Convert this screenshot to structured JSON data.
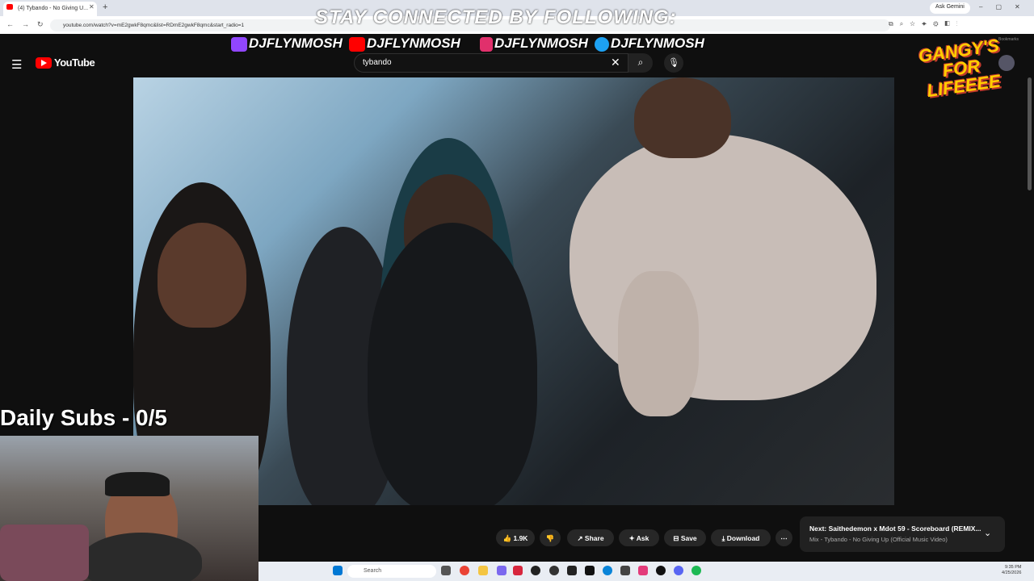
{
  "browser": {
    "tab_title": "(4) Tybando - No Giving U...",
    "url": "youtube.com/watch?v=mE2gwkF8qmc&list=RDmE2gwkF8qmc&start_radio=1",
    "ask_gemini": "Ask Gemini",
    "bookmarks_label": "Bookmarks"
  },
  "overlay": {
    "stay_connected": "STAY CONNECTED BY FOLLOWING:",
    "socials": [
      "DJFLYNMOSH",
      "DJFLYNMOSH",
      "DJFLYNMOSH",
      "DJFLYNMOSH"
    ],
    "daily_subs": "Daily Subs - 0/5",
    "gang_badge": "GANGY'S FOR LIFEEEE"
  },
  "youtube": {
    "brand": "YouTube",
    "search_value": "tybando",
    "actions": {
      "likes": "1.9K",
      "share": "Share",
      "ask": "Ask",
      "save": "Save",
      "download": "Download"
    },
    "next_up": {
      "title": "Next: Saithedemon x Mdot 59 - Scoreboard (REMIX...",
      "subtitle": "Mix - Tybando - No Giving Up (Official Music Video)"
    }
  },
  "taskbar": {
    "search_placeholder": "Search",
    "time": "9:35 PM",
    "date": "4/25/2026"
  },
  "colors": {
    "yt_red": "#ff0000",
    "twitch": "#9146ff",
    "instagram": "#e1306c",
    "twitter": "#1da1f2",
    "badge_yellow": "#ffcc00"
  }
}
